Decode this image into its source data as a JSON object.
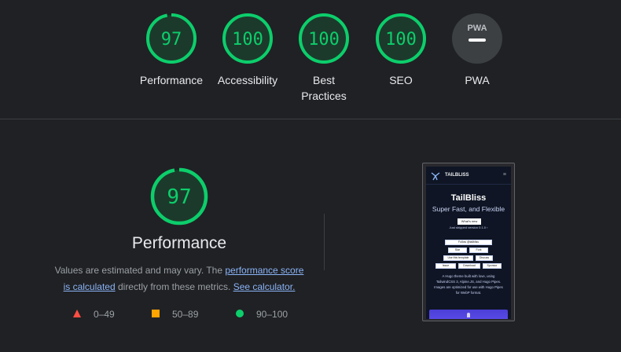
{
  "colors": {
    "pass": "#0cce6b",
    "average": "#ffa400",
    "fail": "#ff4e42",
    "pwa_bg": "#3c4043",
    "link": "#8ab4f8"
  },
  "categories": [
    {
      "label": "Performance",
      "score": 97
    },
    {
      "label": "Accessibility",
      "score": 100
    },
    {
      "label": "Best Practices",
      "score": 100
    },
    {
      "label": "SEO",
      "score": 100
    }
  ],
  "pwa": {
    "label": "PWA",
    "badge_text": "PWA",
    "icon": "pwa-dash-icon"
  },
  "detail": {
    "score": 97,
    "title": "Performance",
    "desc_prefix": "Values are estimated and may vary. The ",
    "link1": "performance score is calculated",
    "desc_middle": " directly from these metrics. ",
    "link2": "See calculator."
  },
  "legend": [
    {
      "range": "0–49",
      "icon": "triangle-icon"
    },
    {
      "range": "50–89",
      "icon": "square-icon"
    },
    {
      "range": "90–100",
      "icon": "circle-icon"
    }
  ],
  "thumbnail": {
    "brand": "TAILBLISS",
    "menu_icon": "≡",
    "heading": "TailBliss",
    "subheading": "Super Fast, and Flexible",
    "badge": "What's new",
    "shipped": "Just shipped version 0.1.0 ›",
    "buttons": [
      "Follow @tailbliss",
      "Star",
      "Fork",
      "Use this template",
      "Discuss",
      "Issue",
      "Download",
      "Sponsor"
    ],
    "paragraph": "A Hugo theme built with love, using TailwindCSS 3, Alpine.JS, and Hugo Pipes. Images are optimized for use with Hugo Pipes for WebP format."
  }
}
